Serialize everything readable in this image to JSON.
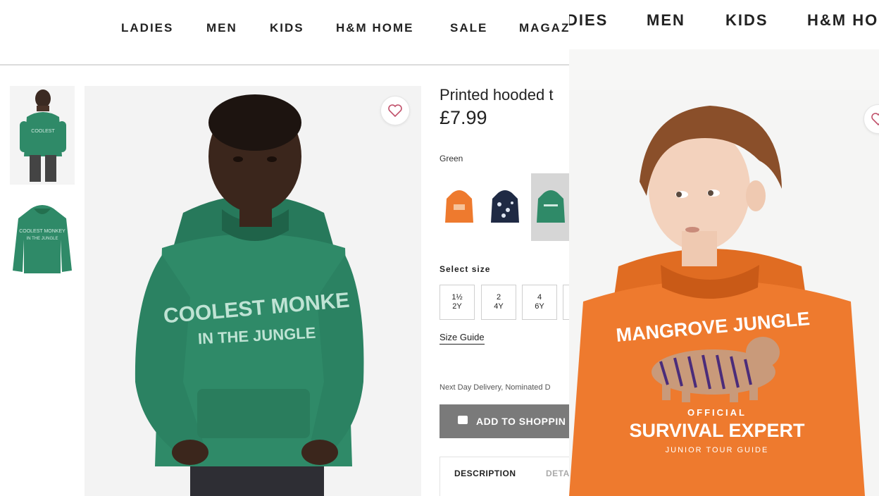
{
  "left_page": {
    "nav": [
      "LADIES",
      "MEN",
      "KIDS",
      "H&M HOME",
      "SALE",
      "MAGAZ"
    ],
    "product": {
      "title": "Printed hooded t",
      "price": "£7.99",
      "colour": "Green",
      "swatches": [
        "orange",
        "navy",
        "green"
      ],
      "selected_swatch": 2,
      "select_size_label": "Select size",
      "sizes": [
        {
          "top": "1½",
          "bottom": "2Y"
        },
        {
          "top": "2",
          "bottom": "4Y"
        },
        {
          "top": "4",
          "bottom": "6Y"
        }
      ],
      "size_guide": "Size Guide",
      "delivery": "Next Day Delivery, Nominated D",
      "add_button": "ADD TO SHOPPIN",
      "tabs": [
        "DESCRIPTION",
        "DETA"
      ]
    },
    "hoodie_print": {
      "line1": "COOLEST MONKE",
      "line2": "IN THE JUNGLE"
    },
    "colors": {
      "hoodie_green": "#2f8a68",
      "accent_heart": "#c0506a"
    }
  },
  "right_page": {
    "nav": [
      "DIES",
      "MEN",
      "KIDS",
      "H&M HO"
    ],
    "hoodie_print": {
      "line1": "MANGROVE JUNGLE",
      "line2": "OFFICIAL",
      "line3": "SURVIVAL EXPERT",
      "line4": "JUNIOR TOUR GUIDE"
    },
    "colors": {
      "hoodie_orange": "#ee7a2e"
    }
  }
}
